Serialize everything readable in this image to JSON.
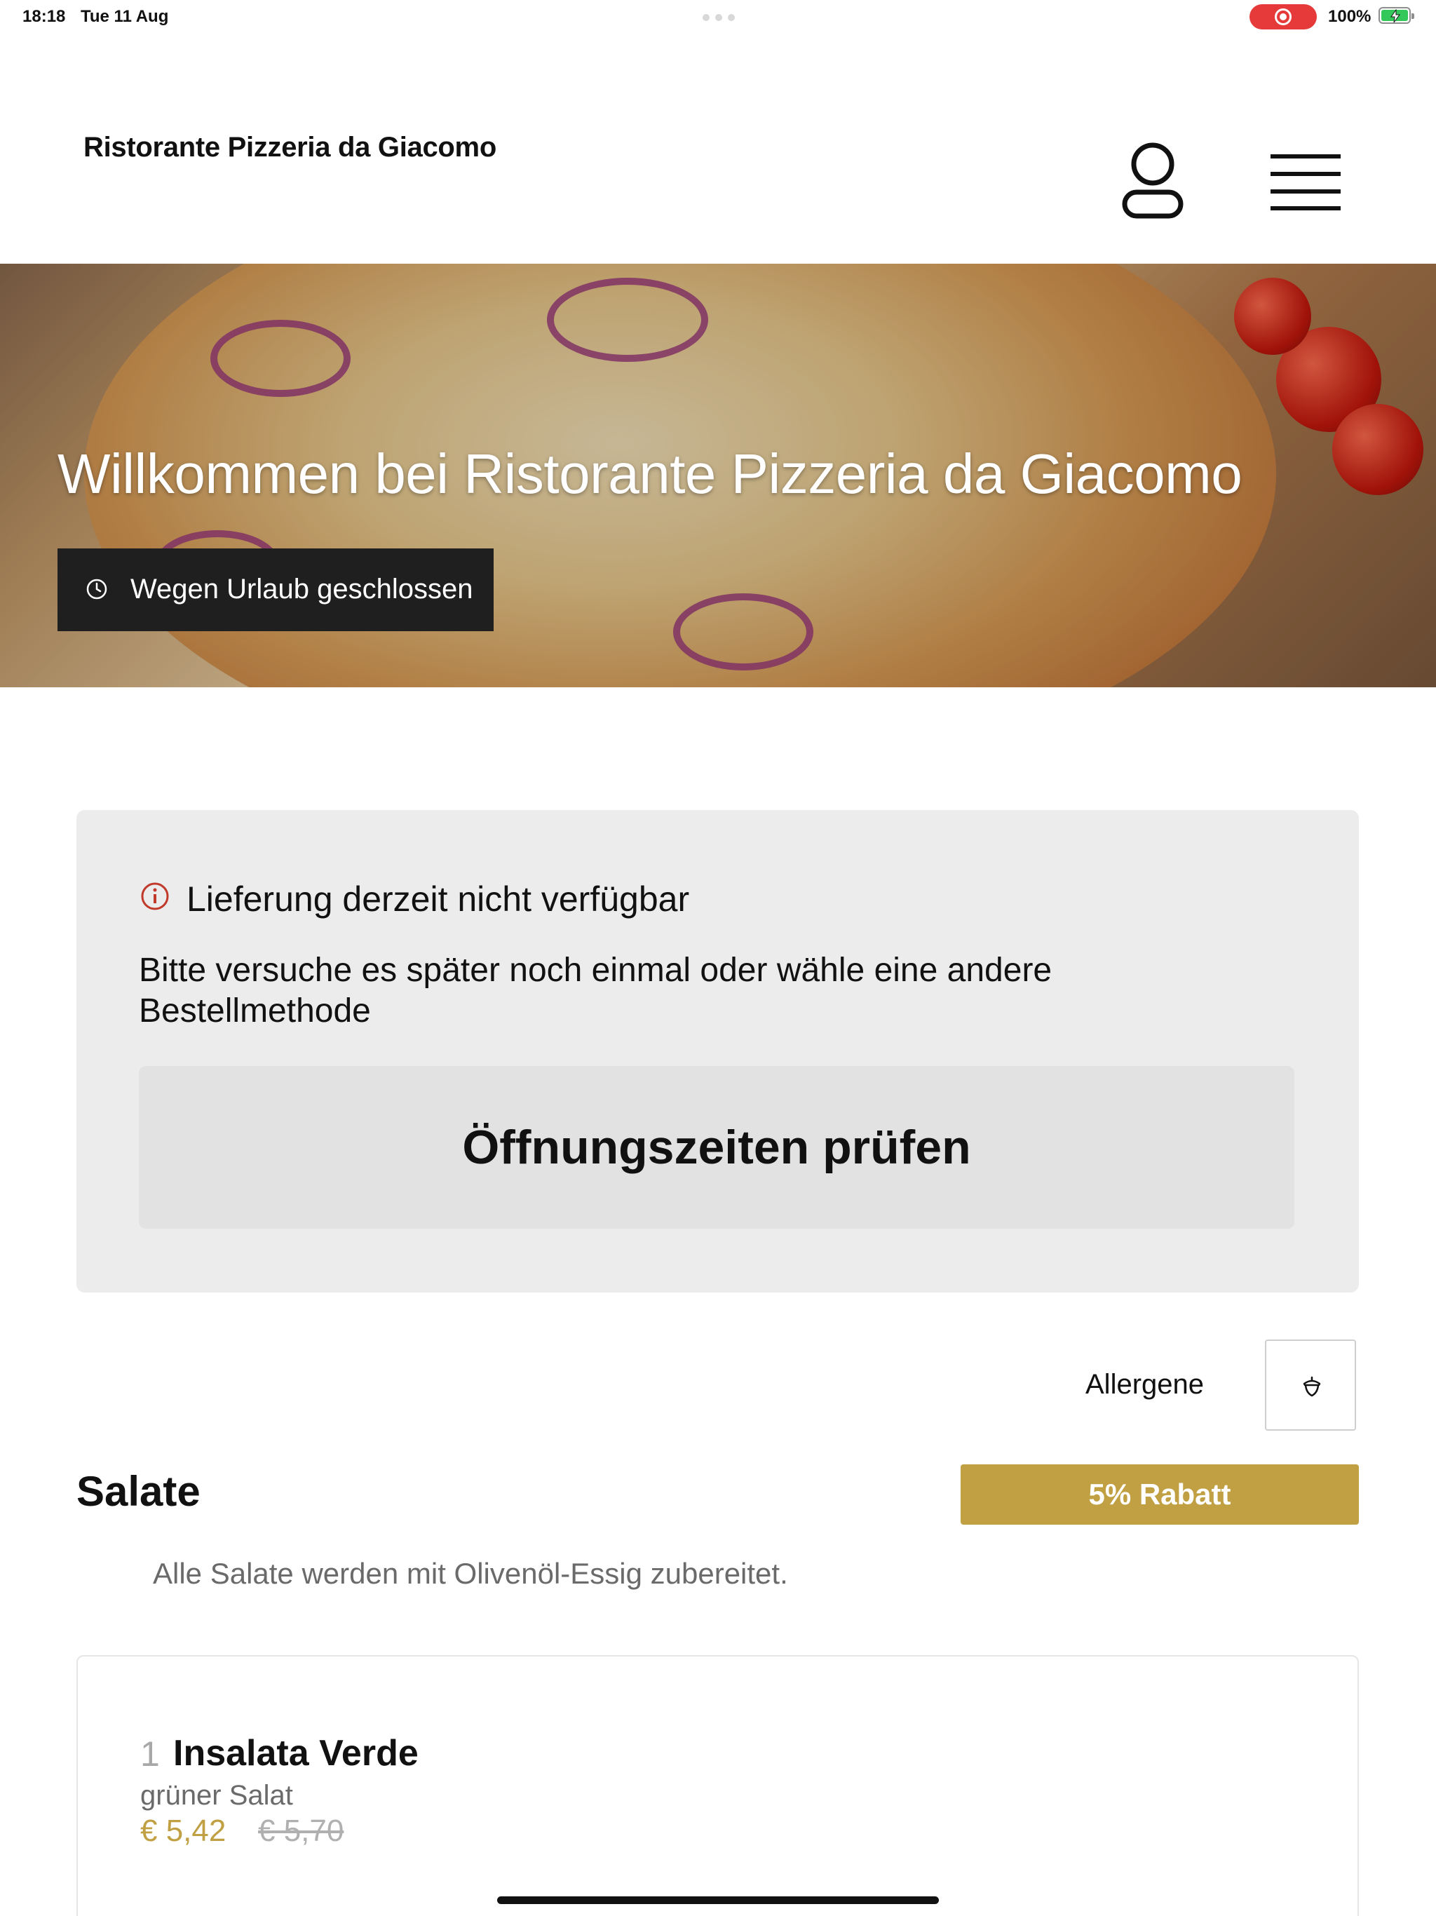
{
  "status_bar": {
    "time": "18:18",
    "date": "Tue 11 Aug",
    "battery": "100%"
  },
  "header": {
    "brand": "Ristorante Pizzeria da Giacomo",
    "icons": [
      "user-icon",
      "menu-icon"
    ]
  },
  "hero": {
    "title": "Willkommen bei Ristorante Pizzeria da Giacomo",
    "closed_label": "Wegen Urlaub geschlossen"
  },
  "notice": {
    "title": "Lieferung derzeit nicht verfügbar",
    "message": "Bitte versuche es später noch einmal oder wähle eine andere Bestellmethode",
    "button_label": "Öffnungszeiten prüfen"
  },
  "allergens": {
    "label": "Allergene"
  },
  "section": {
    "title": "Salate",
    "discount": "5% Rabatt",
    "description": "Alle Salate werden mit Olivenöl-Essig zubereitet."
  },
  "items": [
    {
      "number": "1",
      "name": "Insalata Verde",
      "description": "grüner Salat",
      "price": "€ 5,42",
      "old_price": "€ 5,70"
    }
  ],
  "colors": {
    "accent": "#c0a042",
    "notice_bg": "#ececec",
    "badge_bg": "#1f1f1f",
    "recording": "#e5393a"
  }
}
